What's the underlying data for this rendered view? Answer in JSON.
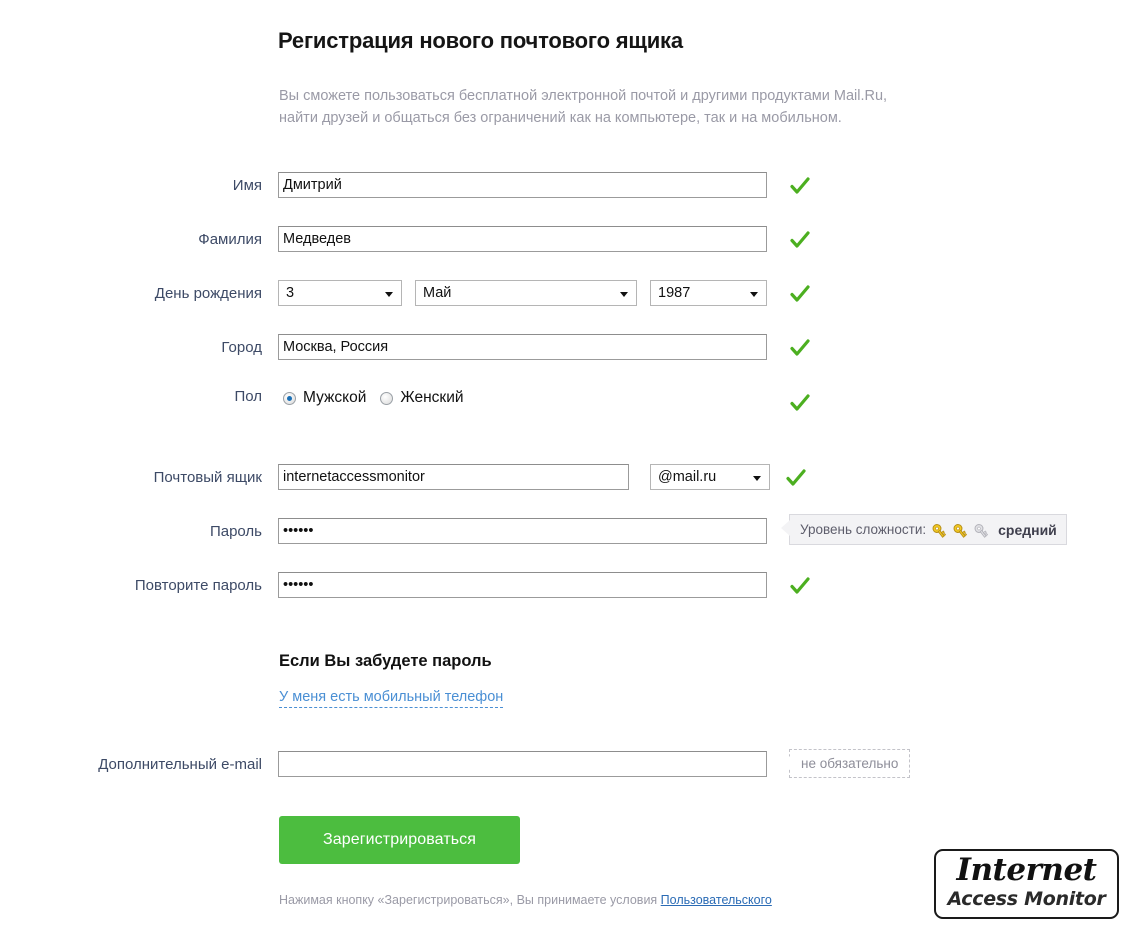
{
  "header": {
    "title": "Регистрация нового почтового ящика",
    "subtitle": "Вы сможете пользоваться бесплатной электронной почтой и другими продуктами Mail.Ru, найти друзей и общаться без ограничений как на компьютере, так и на мобильном."
  },
  "form": {
    "first_name": {
      "label": "Имя",
      "value": "Дмитрий",
      "placeholder": "",
      "valid": true
    },
    "last_name": {
      "label": "Фамилия",
      "value": "Медведев",
      "placeholder": "",
      "valid": true
    },
    "birthday": {
      "label": "День рождения",
      "day": "3",
      "month": "Май",
      "year": "1987",
      "valid": true
    },
    "city": {
      "label": "Город",
      "value": "Москва, Россия",
      "placeholder": "",
      "valid": true
    },
    "gender": {
      "label": "Пол",
      "options": [
        {
          "label": "Мужской",
          "selected": true
        },
        {
          "label": "Женский",
          "selected": false
        }
      ],
      "valid": true
    },
    "mailbox": {
      "label": "Почтовый ящик",
      "value": "internetaccessmonitor",
      "placeholder": "",
      "domain": "@mail.ru",
      "valid": true
    },
    "password": {
      "label": "Пароль",
      "value": "••••••",
      "placeholder": "",
      "strength_label": "Уровень сложности:",
      "strength_word": "средний",
      "strength_keys_filled": 2,
      "strength_keys_total": 3
    },
    "password_repeat": {
      "label": "Повторите пароль",
      "value": "••••••",
      "placeholder": "",
      "valid": true
    },
    "extra_email": {
      "label": "Дополнительный e-mail",
      "value": "",
      "placeholder": "",
      "hint": "не обязательно"
    }
  },
  "forgot": {
    "title": "Если Вы забудете пароль",
    "link": "У меня есть мобильный телефон"
  },
  "submit": {
    "label": "Зарегистрироваться"
  },
  "legal": {
    "before": "Нажимая кнопку «Зарегистрироваться», Вы принимаете условия ",
    "link": "Пользовательского"
  },
  "watermark": {
    "line1": "Internet",
    "line2": "Access Monitor"
  },
  "colors": {
    "accent_green": "#4cbd3f",
    "check_green": "#4caf20",
    "label_blue_gray": "#3d4a66",
    "link_blue": "#4a8fd4",
    "legal_link_blue": "#2a6bb5",
    "muted_gray": "#9a9aa6",
    "key_gold": "#f2c21a",
    "key_gray": "#c9c9cf",
    "radio_dot_blue": "#1b6fb5"
  }
}
